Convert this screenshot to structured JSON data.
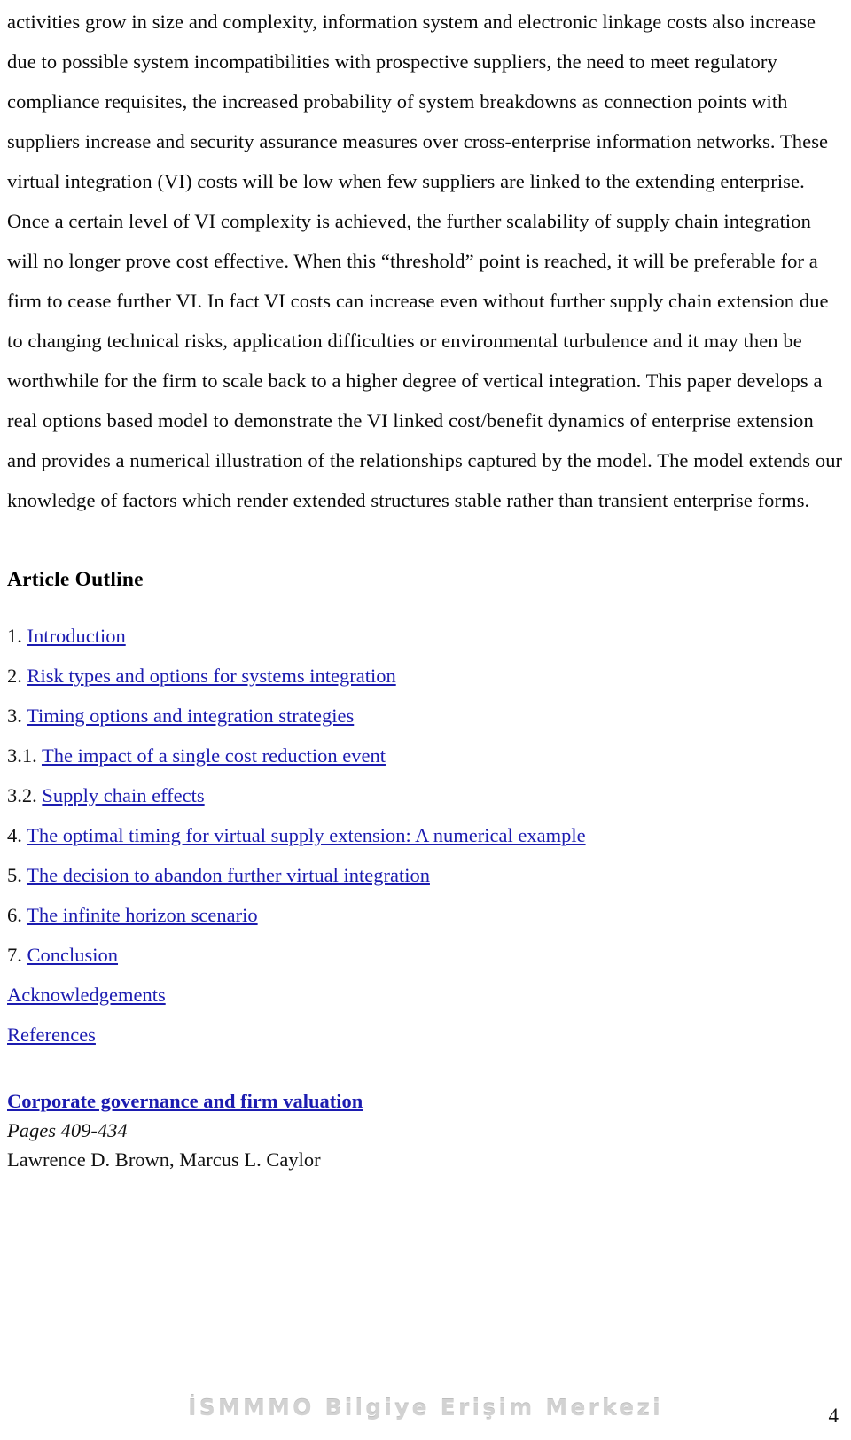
{
  "document": {
    "abstract_paragraph": "activities grow in size and complexity, information system and electronic linkage costs also increase due to possible system incompatibilities with prospective suppliers, the need to meet regulatory compliance requisites, the increased probability of system breakdowns as connection points with suppliers increase and security assurance measures over cross-enterprise information networks. These virtual integration (VI) costs will be low when few suppliers are linked to the extending enterprise. Once a certain level of VI complexity is achieved, the further scalability of supply chain integration will no longer prove cost effective. When this “threshold” point is reached, it will be preferable for a firm to cease further VI. In fact VI costs can increase even without further supply chain extension due to changing technical risks, application difficulties or environmental turbulence and it may then be worthwhile for the firm to scale back to a higher degree of vertical integration. This paper develops a real options based model to demonstrate the VI linked cost/benefit dynamics of enterprise extension and provides a numerical illustration of the relationships captured by the model. The model extends our knowledge of factors which render extended structures stable rather than transient enterprise forms."
  },
  "outline": {
    "heading": "Article Outline",
    "items": [
      {
        "number": "1.",
        "label": "Introduction"
      },
      {
        "number": "2.",
        "label": "Risk types and options for systems integration"
      },
      {
        "number": "3.",
        "label": "Timing options and integration strategies"
      },
      {
        "number": "3.1.",
        "label": "The impact of a single cost reduction event"
      },
      {
        "number": "3.2.",
        "label": "Supply chain effects"
      },
      {
        "number": "4.",
        "label": "The optimal timing for virtual supply extension: A numerical example"
      },
      {
        "number": "5.",
        "label": "The decision to abandon further virtual integration"
      },
      {
        "number": "6.",
        "label": "The infinite horizon scenario"
      },
      {
        "number": "7.",
        "label": "Conclusion"
      }
    ],
    "extra_links": [
      {
        "label": "Acknowledgements"
      },
      {
        "label": "References"
      }
    ]
  },
  "next_article": {
    "title": "Corporate governance and firm valuation",
    "pages": "Pages 409-434",
    "authors": "Lawrence D. Brown, Marcus L. Caylor"
  },
  "footer": {
    "watermark": "İSMMMO Bilgiye Erişim Merkezi",
    "page_number": "4"
  },
  "colors": {
    "link_blue": "#1c1cb0",
    "text_black": "#0a0a0a",
    "watermark_gray": "#d2d2d2"
  }
}
